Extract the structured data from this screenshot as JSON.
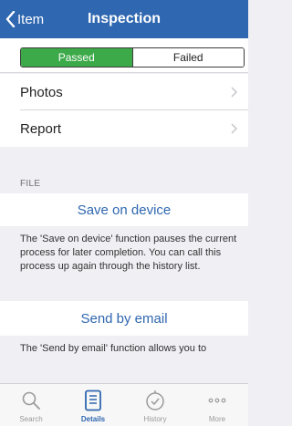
{
  "colors": {
    "nav": "#2f67b0",
    "passed": "#3daa4a",
    "link": "#2f67b0"
  },
  "nav": {
    "back_label": "Item",
    "title": "Inspection"
  },
  "status": {
    "passed_label": "Passed",
    "failed_label": "Failed",
    "selected": "Passed"
  },
  "list": {
    "photos": "Photos",
    "report": "Report"
  },
  "file": {
    "header": "FILE",
    "save_label": "Save on device",
    "save_desc": "The 'Save on device' function pauses the current process for later completion. You can call this process up again through the history list.",
    "email_label": "Send by email",
    "email_desc": "The 'Send by email' function allows you to"
  },
  "tabs": [
    {
      "label": "Search",
      "icon": "search-icon"
    },
    {
      "label": "Details",
      "icon": "details-icon",
      "active": true
    },
    {
      "label": "History",
      "icon": "history-icon"
    },
    {
      "label": "More",
      "icon": "more-icon"
    }
  ]
}
